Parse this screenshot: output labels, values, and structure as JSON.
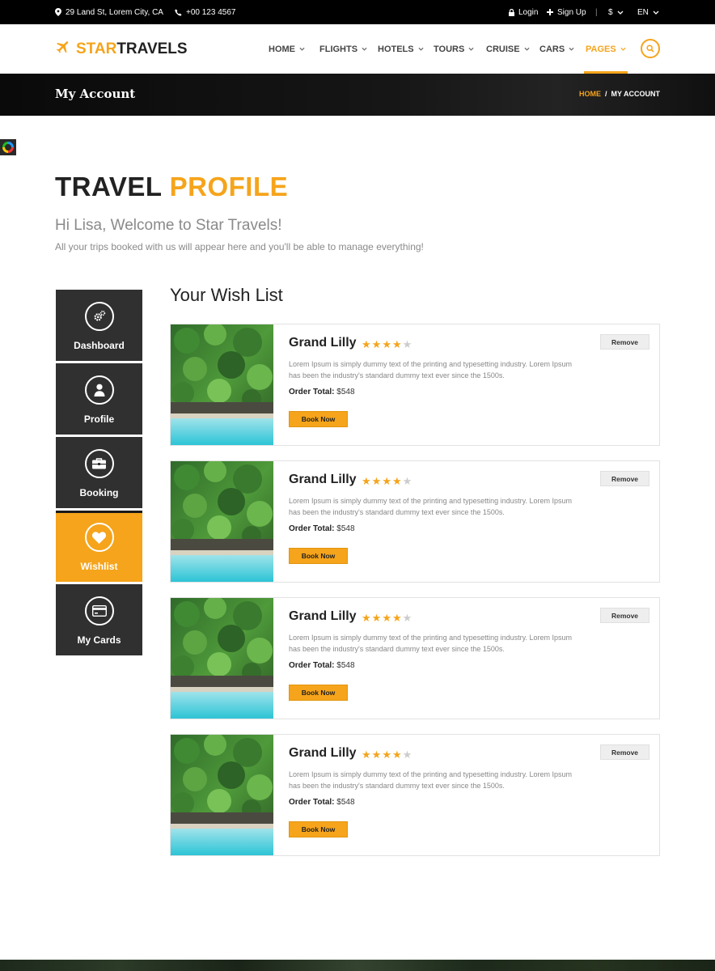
{
  "topbar": {
    "address": "29 Land St, Lorem City, CA",
    "phone": "+00 123 4567",
    "login": "Login",
    "signup": "Sign Up",
    "currency": "$",
    "language": "EN"
  },
  "brand": {
    "part1": "STAR",
    "part2": "TRAVELS",
    "accent_color": "#f5a41b"
  },
  "nav": {
    "items": [
      {
        "label": "HOME"
      },
      {
        "label": "FLIGHTS"
      },
      {
        "label": "HOTELS"
      },
      {
        "label": "TOURS"
      },
      {
        "label": "CRUISE"
      },
      {
        "label": "CARS"
      },
      {
        "label": "PAGES",
        "active": true
      }
    ]
  },
  "banner": {
    "title": "My Account",
    "breadcrumb_home": "HOME",
    "breadcrumb_sep": "/",
    "breadcrumb_current": "MY ACCOUNT"
  },
  "profile": {
    "title_part1": "TRAVEL",
    "title_part2": "PROFILE",
    "welcome": "Hi Lisa, Welcome to Star Travels!",
    "subtitle": "All your trips booked with us will appear here and you'll be able to manage everything!"
  },
  "sidebar": {
    "items": [
      {
        "label": "Dashboard",
        "icon": "gears-icon"
      },
      {
        "label": "Profile",
        "icon": "user-icon"
      },
      {
        "label": "Booking",
        "icon": "briefcase-icon"
      },
      {
        "label": "Wishlist",
        "icon": "heart-icon",
        "active": true
      },
      {
        "label": "My Cards",
        "icon": "credit-card-icon"
      }
    ]
  },
  "wishlist": {
    "title": "Your Wish List",
    "items": [
      {
        "name": "Grand Lilly",
        "rating": 4,
        "max_rating": 5,
        "description": "Lorem Ipsum is simply dummy text of the printing and typesetting industry. Lorem Ipsum has been the industry's standard dummy text ever since the 1500s.",
        "total_label": "Order Total:",
        "total_value": "$548",
        "book_label": "Book Now",
        "remove_label": "Remove"
      },
      {
        "name": "Grand Lilly",
        "rating": 4,
        "max_rating": 5,
        "description": "Lorem Ipsum is simply dummy text of the printing and typesetting industry. Lorem Ipsum has been the industry's standard dummy text ever since the 1500s.",
        "total_label": "Order Total:",
        "total_value": "$548",
        "book_label": "Book Now",
        "remove_label": "Remove"
      },
      {
        "name": "Grand Lilly",
        "rating": 4,
        "max_rating": 5,
        "description": "Lorem Ipsum is simply dummy text of the printing and typesetting industry. Lorem Ipsum has been the industry's standard dummy text ever since the 1500s.",
        "total_label": "Order Total:",
        "total_value": "$548",
        "book_label": "Book Now",
        "remove_label": "Remove"
      },
      {
        "name": "Grand Lilly",
        "rating": 4,
        "max_rating": 5,
        "description": "Lorem Ipsum is simply dummy text of the printing and typesetting industry. Lorem Ipsum has been the industry's standard dummy text ever since the 1500s.",
        "total_label": "Order Total:",
        "total_value": "$548",
        "book_label": "Book Now",
        "remove_label": "Remove"
      }
    ]
  },
  "colors": {
    "accent": "#f5a41b",
    "dark": "#303030",
    "star_empty": "#cccccc"
  }
}
